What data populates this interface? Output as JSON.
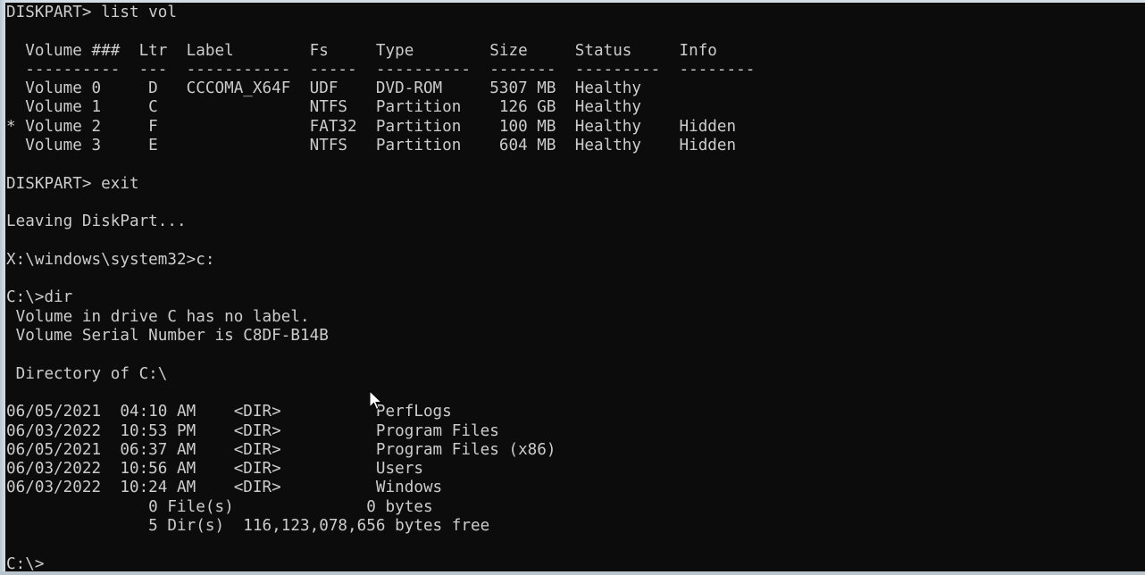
{
  "window": {
    "type": "command-prompt",
    "background_color": "#0c0c0c",
    "text_color": "#cccccc"
  },
  "console": {
    "lines": [
      "DISKPART> list vol",
      "",
      "  Volume ###  Ltr  Label        Fs     Type        Size     Status     Info",
      "  ----------  ---  -----------  -----  ----------  -------  ---------  --------",
      "  Volume 0     D   CCCOMA_X64F  UDF    DVD-ROM     5307 MB  Healthy",
      "  Volume 1     C                NTFS   Partition    126 GB  Healthy",
      "* Volume 2     F                FAT32  Partition    100 MB  Healthy    Hidden",
      "  Volume 3     E                NTFS   Partition    604 MB  Healthy    Hidden",
      "",
      "DISKPART> exit",
      "",
      "Leaving DiskPart...",
      "",
      "X:\\windows\\system32>c:",
      "",
      "C:\\>dir",
      " Volume in drive C has no label.",
      " Volume Serial Number is C8DF-B14B",
      "",
      " Directory of C:\\",
      "",
      "06/05/2021  04:10 AM    <DIR>          PerfLogs",
      "06/03/2022  10:53 PM    <DIR>          Program Files",
      "06/05/2021  06:37 AM    <DIR>          Program Files (x86)",
      "06/03/2022  10:56 AM    <DIR>          Users",
      "06/03/2022  10:24 AM    <DIR>          Windows",
      "               0 File(s)              0 bytes",
      "               5 Dir(s)  116,123,078,656 bytes free",
      "",
      "C:\\>"
    ]
  },
  "diskpart_volumes": {
    "columns": [
      "Volume ###",
      "Ltr",
      "Label",
      "Fs",
      "Type",
      "Size",
      "Status",
      "Info"
    ],
    "rows": [
      {
        "selected": false,
        "volume": "Volume 0",
        "ltr": "D",
        "label": "CCCOMA_X64F",
        "fs": "UDF",
        "type": "DVD-ROM",
        "size": "5307 MB",
        "status": "Healthy",
        "info": ""
      },
      {
        "selected": false,
        "volume": "Volume 1",
        "ltr": "C",
        "label": "",
        "fs": "NTFS",
        "type": "Partition",
        "size": "126 GB",
        "status": "Healthy",
        "info": ""
      },
      {
        "selected": true,
        "volume": "Volume 2",
        "ltr": "F",
        "label": "",
        "fs": "FAT32",
        "type": "Partition",
        "size": "100 MB",
        "status": "Healthy",
        "info": "Hidden"
      },
      {
        "selected": false,
        "volume": "Volume 3",
        "ltr": "E",
        "label": "",
        "fs": "NTFS",
        "type": "Partition",
        "size": "604 MB",
        "status": "Healthy",
        "info": "Hidden"
      }
    ]
  },
  "directory_listing": {
    "path": "C:\\",
    "volume_label_text": "Volume in drive C has no label.",
    "serial_number": "C8DF-B14B",
    "entries": [
      {
        "date": "06/05/2021",
        "time": "04:10 AM",
        "kind": "<DIR>",
        "name": "PerfLogs"
      },
      {
        "date": "06/03/2022",
        "time": "10:53 PM",
        "kind": "<DIR>",
        "name": "Program Files"
      },
      {
        "date": "06/05/2021",
        "time": "06:37 AM",
        "kind": "<DIR>",
        "name": "Program Files (x86)"
      },
      {
        "date": "06/03/2022",
        "time": "10:56 AM",
        "kind": "<DIR>",
        "name": "Users"
      },
      {
        "date": "06/03/2022",
        "time": "10:24 AM",
        "kind": "<DIR>",
        "name": "Windows"
      }
    ],
    "file_count": "0 File(s)",
    "file_bytes": "0 bytes",
    "dir_count": "5 Dir(s)",
    "free_bytes": "116,123,078,656 bytes free"
  },
  "prompt": "C:\\>",
  "mouse_cursor": "arrow-pointer"
}
